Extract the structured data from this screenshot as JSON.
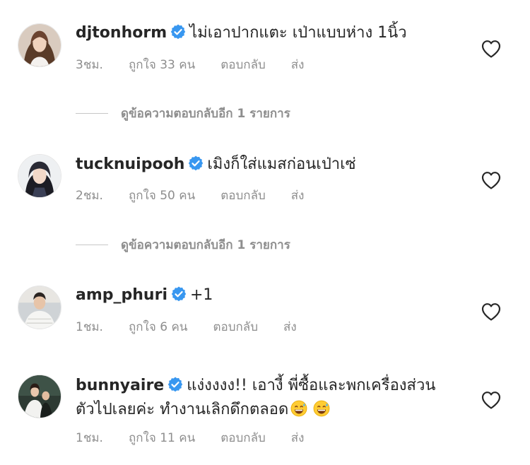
{
  "comments": [
    {
      "username": "djtonhorm",
      "text": "ไม่เอาปากแตะ เป่าแบบห่าง 1นิ้ว",
      "time": "3ชม.",
      "likes": "ถูกใจ 33 คน",
      "reply": "ตอบกลับ",
      "send": "ส่ง",
      "view_replies": "ดูข้อความตอบกลับอีก 1 รายการ"
    },
    {
      "username": "tucknuipooh",
      "text": "เมิงก็ใส่แมสก่อนเป่าเซ่",
      "time": "2ชม.",
      "likes": "ถูกใจ 50 คน",
      "reply": "ตอบกลับ",
      "send": "ส่ง",
      "view_replies": "ดูข้อความตอบกลับอีก 1 รายการ"
    },
    {
      "username": "amp_phuri",
      "text": "+1",
      "time": "1ชม.",
      "likes": "ถูกใจ 6 คน",
      "reply": "ตอบกลับ",
      "send": "ส่ง"
    },
    {
      "username": "bunnyaire",
      "text": "แง่งงงง!! เอางี้ พี่ซื้อและพกเครื่องส่วนตัวไปเลยค่ะ ทำงานเลิกดึกตลอด",
      "time": "1ชม.",
      "likes": "ถูกใจ 11 คน",
      "reply": "ตอบกลับ",
      "send": "ส่ง"
    }
  ],
  "icons": {
    "verified": "verified-badge-icon",
    "like": "heart-outline-icon",
    "emoji": "grinning-sweat-emoji"
  },
  "colors": {
    "verified_blue": "#3897f0",
    "text": "#262626",
    "meta_gray": "#8e8e8e"
  }
}
